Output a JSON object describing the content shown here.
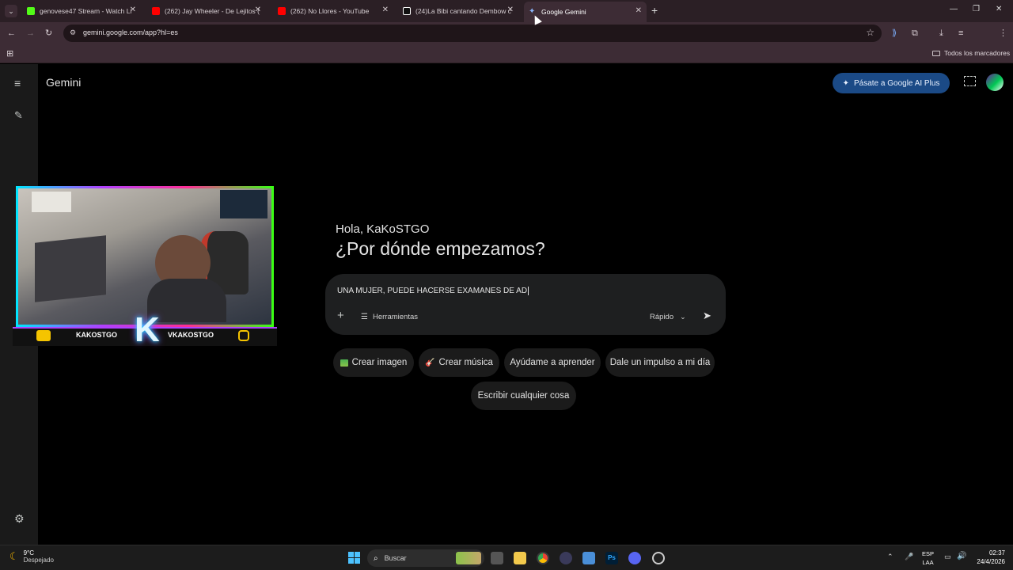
{
  "tabs": [
    {
      "title": "genovese47 Stream - Watch Li",
      "favicon_color": "#53fc18"
    },
    {
      "title": "(262) Jay Wheeler - De Lejitos (",
      "favicon_color": "#ff0000"
    },
    {
      "title": "(262) No Llores - YouTube",
      "favicon_color": "#ff0000"
    },
    {
      "title": "(24)La Bibi cantando Dembow c",
      "favicon_color": "#ffffff"
    },
    {
      "title": "Google Gemini",
      "favicon_color": "#8ab4f8"
    }
  ],
  "address_bar": {
    "url": "gemini.google.com/app?hl=es"
  },
  "bookmarks": {
    "all_label": "Todos los marcadores"
  },
  "app": {
    "title": "Gemini",
    "upgrade_label": "Pásate a Google AI Plus"
  },
  "greeting": {
    "hello": "Hola, KaKoSTGO",
    "question": "¿Por dónde empezamos?"
  },
  "prompt": {
    "value": "UNA MUJER, PUEDE HACERSE EXAMANES DE AD",
    "tools_label": "Herramientas",
    "model_label": "Rápido"
  },
  "chips": {
    "image": "Crear imagen",
    "music": "Crear música",
    "learn": "Ayúdame a aprender",
    "boost": "Dale un impulso a mi día",
    "write": "Escribir cualquier cosa"
  },
  "stream_overlay": {
    "left_name": "KAKOSTGO",
    "right_name": "VKAKOSTGO",
    "logo_letter": "K"
  },
  "taskbar": {
    "weather_temp": "9°C",
    "weather_desc": "Despejado",
    "search_label": "Buscar",
    "lang_top": "ESP",
    "lang_bottom": "LAA",
    "time": "02:37",
    "date": "24/4/2026"
  },
  "colors": {
    "accent_blue": "#1b4a86",
    "chrome_bg": "#3d2c35",
    "overlay_purple": "#a040ff"
  }
}
